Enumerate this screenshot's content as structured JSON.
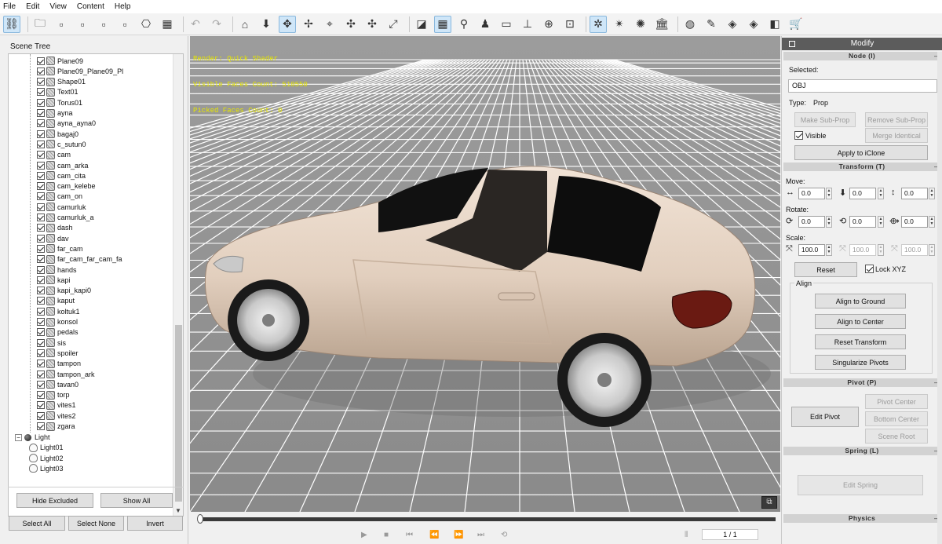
{
  "menu": [
    "File",
    "Edit",
    "View",
    "Content",
    "Help"
  ],
  "toolbar": {
    "icons": [
      "scene-tree-icon",
      "open-folder-icon",
      "save-icon",
      "fbx-export-icon",
      "export-icon",
      "obj-export-icon",
      "model-icon",
      "terrain-icon",
      "undo-icon",
      "redo-icon",
      "home-icon",
      "move-down-icon",
      "move-icon",
      "rotate-icon",
      "pick-icon",
      "pan-icon",
      "orbit-icon",
      "scale-icon",
      "wireframe-icon",
      "grid-icon",
      "ik-icon",
      "pin-icon",
      "plane-icon",
      "ground-icon",
      "globe-icon",
      "focus-icon",
      "light-icon",
      "spotlight-icon",
      "sun-icon",
      "museum-icon",
      "sphere-icon",
      "wrench-icon",
      "group-icon",
      "paint-icon",
      "copy-icon",
      "cart-icon"
    ],
    "glyphs": [
      "⛓",
      "🗀",
      "▫",
      "▫",
      "▫",
      "▫",
      "⎔",
      "▦",
      "↶",
      "↷",
      "⌂",
      "⬇",
      "✥",
      "✢",
      "⌖",
      "✣",
      "✣",
      "⤢",
      "◪",
      "▦",
      "⚲",
      "♟",
      "▭",
      "⊥",
      "⊕",
      "⊡",
      "✲",
      "✴",
      "✺",
      "🏛",
      "◍",
      "✎",
      "◈",
      "◈",
      "◧",
      "🛒"
    ],
    "active": [
      "scene-tree-icon",
      "move-icon",
      "grid-icon",
      "light-icon"
    ]
  },
  "scene_tree": {
    "title": "Scene Tree",
    "props": [
      "Plane09",
      "Plane09_Plane09_Pl",
      "Shape01",
      "Text01",
      "Torus01",
      "ayna",
      "ayna_ayna0",
      "bagaj0",
      "c_sutun0",
      "cam",
      "cam_arka",
      "cam_cita",
      "cam_kelebe",
      "cam_on",
      "camurluk",
      "camurluk_a",
      "dash",
      "dav",
      "far_cam",
      "far_cam_far_cam_fa",
      "hands",
      "kapi",
      "kapi_kapi0",
      "kaput",
      "koltuk1",
      "konsol",
      "pedals",
      "sis",
      "spoiler",
      "tampon",
      "tampon_ark",
      "tavan0",
      "torp",
      "vites1",
      "vites2",
      "zgara"
    ],
    "light_group": "Light",
    "lights": [
      "Light01",
      "Light02",
      "Light03"
    ],
    "hide_excluded": "Hide Excluded",
    "show_all": "Show All",
    "select_all": "Select All",
    "select_none": "Select None",
    "invert": "Invert"
  },
  "viewport": {
    "stats": [
      "Render: Quick Shader",
      "Visible Faces Count: 510550",
      "Picked Faces Count: 0"
    ]
  },
  "timeline": {
    "frame": "1 / 1"
  },
  "modify": {
    "title": "Modify",
    "node_header": "Node (I)",
    "selected_label": "Selected:",
    "selected_value": "OBJ",
    "type_label": "Type:",
    "type_value": "Prop",
    "make_sub_prop": "Make Sub-Prop",
    "remove_sub_prop": "Remove Sub-Prop",
    "visible_label": "Visible",
    "merge_identical": "Merge Identical",
    "apply_iclone": "Apply to iClone",
    "transform_header": "Transform (T)",
    "move_label": "Move:",
    "move_values": [
      "0.0",
      "0.0",
      "0.0"
    ],
    "rotate_label": "Rotate:",
    "rotate_values": [
      "0.0",
      "0.0",
      "0.0"
    ],
    "scale_label": "Scale:",
    "scale_values": [
      "100.0",
      "100.0",
      "100.0"
    ],
    "reset": "Reset",
    "lock_xyz": "Lock XYZ",
    "align_label": "Align",
    "align_ground": "Align to Ground",
    "align_center": "Align to Center",
    "reset_transform": "Reset Transform",
    "singularize": "Singularize Pivots",
    "pivot_header": "Pivot (P)",
    "edit_pivot": "Edit Pivot",
    "pivot_center": "Pivot Center",
    "bottom_center": "Bottom Center",
    "scene_root": "Scene Root",
    "spring_header": "Spring (L)",
    "edit_spring": "Edit Spring",
    "physics_header": "Physics"
  }
}
